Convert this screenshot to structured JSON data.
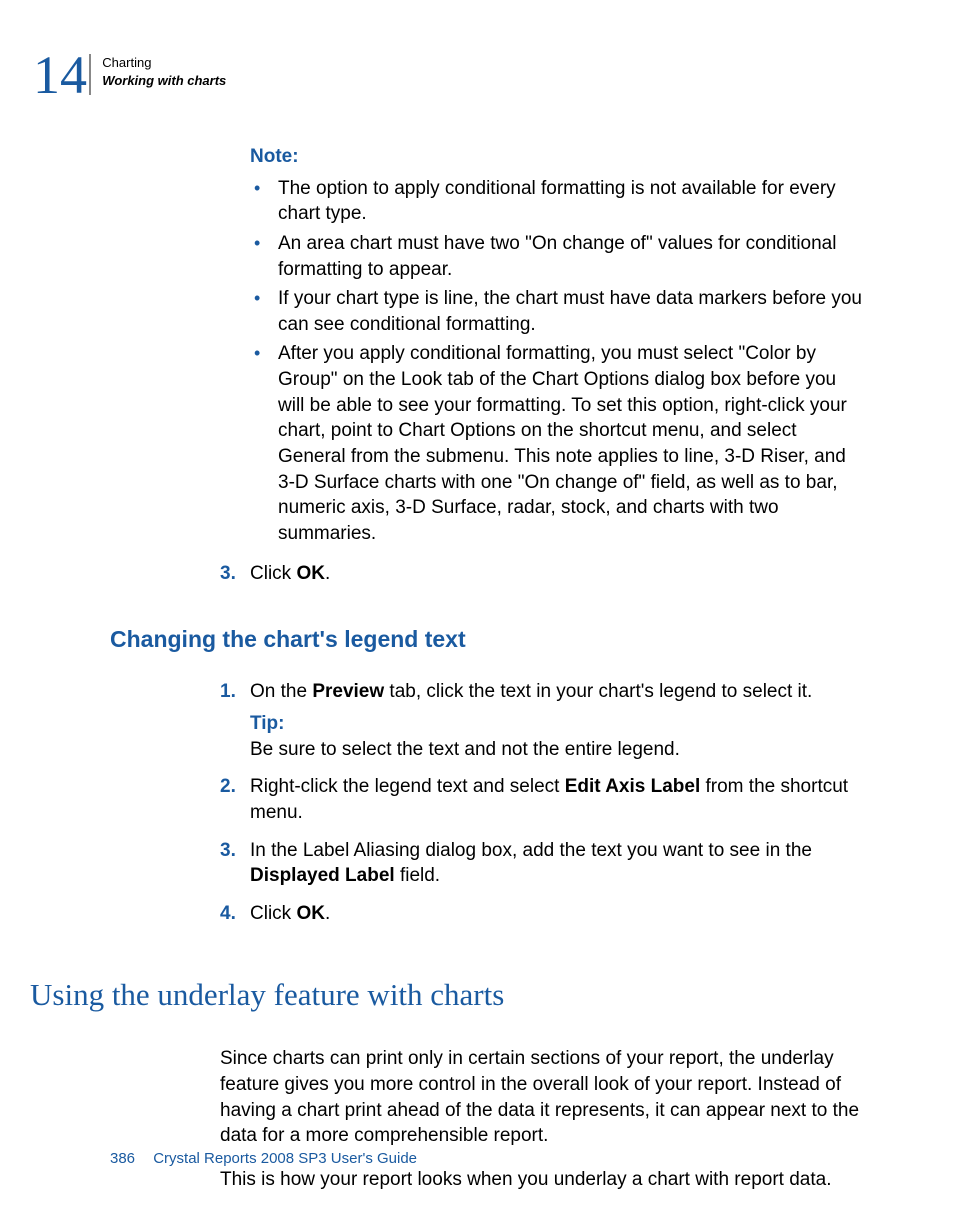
{
  "header": {
    "chapter_number": "14",
    "chapter_title": "Charting",
    "section_title": "Working with charts"
  },
  "note": {
    "label": "Note:",
    "items": [
      "The option to apply conditional formatting is not available for every chart type.",
      "An area chart must have two \"On change of\" values for conditional formatting to appear.",
      "If your chart type is line, the chart must have data markers before you can see conditional formatting.",
      "After you apply conditional formatting, you must select \"Color by Group\" on the Look tab of the Chart Options dialog box before you will be able to see your formatting. To set this option, right-click your chart, point to Chart Options on the shortcut menu, and select General from the submenu. This note applies to line, 3-D Riser, and 3-D Surface charts with one \"On change of\" field, as well as to bar, numeric axis, 3-D Surface, radar, stock, and charts with two summaries."
    ]
  },
  "step_continue": {
    "num": "3.",
    "pre": "Click ",
    "bold": "OK",
    "post": "."
  },
  "section_legend": {
    "heading": "Changing the chart's legend text",
    "step1": {
      "num": "1.",
      "pre": "On the ",
      "bold": "Preview",
      "post": " tab, click the text in your chart's legend to select it."
    },
    "tip": {
      "label": "Tip:",
      "text": "Be sure to select the text and not the entire legend."
    },
    "step2": {
      "num": "2.",
      "pre": "Right-click the legend text and select ",
      "bold": "Edit Axis Label",
      "post": " from the shortcut menu."
    },
    "step3": {
      "num": "3.",
      "pre": "In the Label Aliasing dialog box, add the text you want to see in the ",
      "bold": "Displayed Label",
      "post": " field."
    },
    "step4": {
      "num": "4.",
      "pre": "Click ",
      "bold": "OK",
      "post": "."
    }
  },
  "section_underlay": {
    "heading": "Using the underlay feature with charts",
    "para1": "Since charts can print only in certain sections of your report, the underlay feature gives you more control in the overall look of your report. Instead of having a chart print ahead of the data it represents, it can appear next to the data for a more comprehensible report.",
    "para2": "This is how your report looks when you underlay a chart with report data."
  },
  "footer": {
    "page": "386",
    "title": "Crystal Reports 2008 SP3 User's Guide"
  }
}
